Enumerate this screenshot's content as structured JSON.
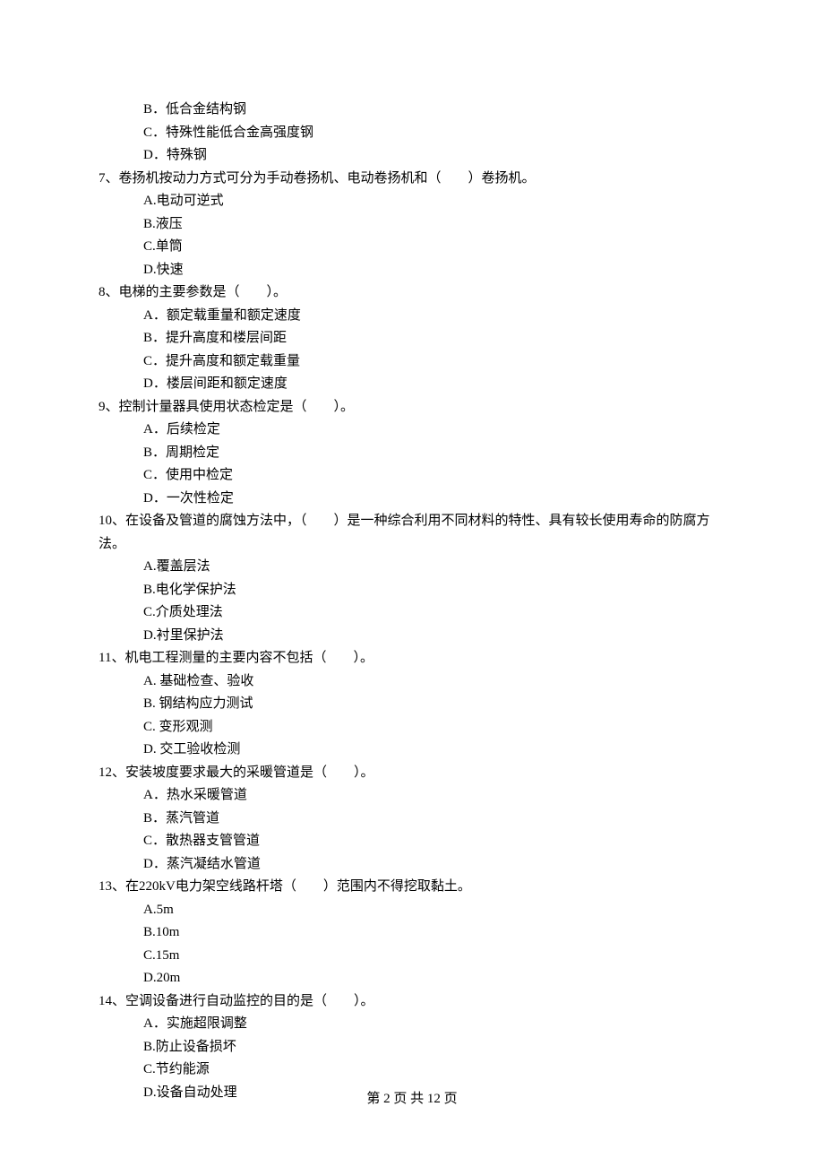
{
  "footer": {
    "text": "第 2 页 共 12 页"
  },
  "leadOptions": {
    "B": "B．低合金结构钢",
    "C": "C．特殊性能低合金高强度钢",
    "D": "D．特殊钢"
  },
  "questions": [
    {
      "stem": "7、卷扬机按动力方式可分为手动卷扬机、电动卷扬机和（　　）卷扬机。",
      "options": [
        "A.电动可逆式",
        "B.液压",
        "C.单筒",
        "D.快速"
      ]
    },
    {
      "stem": "8、电梯的主要参数是（　　）。",
      "options": [
        "A．额定载重量和额定速度",
        "B．提升高度和楼层间距",
        "C．提升高度和额定载重量",
        "D．楼层间距和额定速度"
      ]
    },
    {
      "stem": "9、控制计量器具使用状态检定是（　　）。",
      "options": [
        "A．后续检定",
        "B．周期检定",
        "C．使用中检定",
        "D．一次性检定"
      ]
    },
    {
      "stem": "10、在设备及管道的腐蚀方法中，（　　）是一种综合利用不同材料的特性、具有较长使用寿命的防腐方法。",
      "options": [
        "A.覆盖层法",
        "B.电化学保护法",
        "C.介质处理法",
        "D.衬里保护法"
      ]
    },
    {
      "stem": "11、机电工程测量的主要内容不包括（　　）。",
      "options": [
        "A. 基础检查、验收",
        "B. 钢结构应力测试",
        "C. 变形观测",
        "D. 交工验收检测"
      ]
    },
    {
      "stem": "12、安装坡度要求最大的采暖管道是（　　）。",
      "options": [
        "A．热水采暖管道",
        "B．蒸汽管道",
        "C．散热器支管管道",
        "D．蒸汽凝结水管道"
      ]
    },
    {
      "stem": "13、在220kV电力架空线路杆塔（　　）范围内不得挖取黏土。",
      "options": [
        "A.5m",
        "B.10m",
        "C.15m",
        "D.20m"
      ]
    },
    {
      "stem": "14、空调设备进行自动监控的目的是（　　）。",
      "options": [
        "A．实施超限调整",
        "B.防止设备损坏",
        "C.节约能源",
        "D.设备自动处理"
      ]
    }
  ]
}
